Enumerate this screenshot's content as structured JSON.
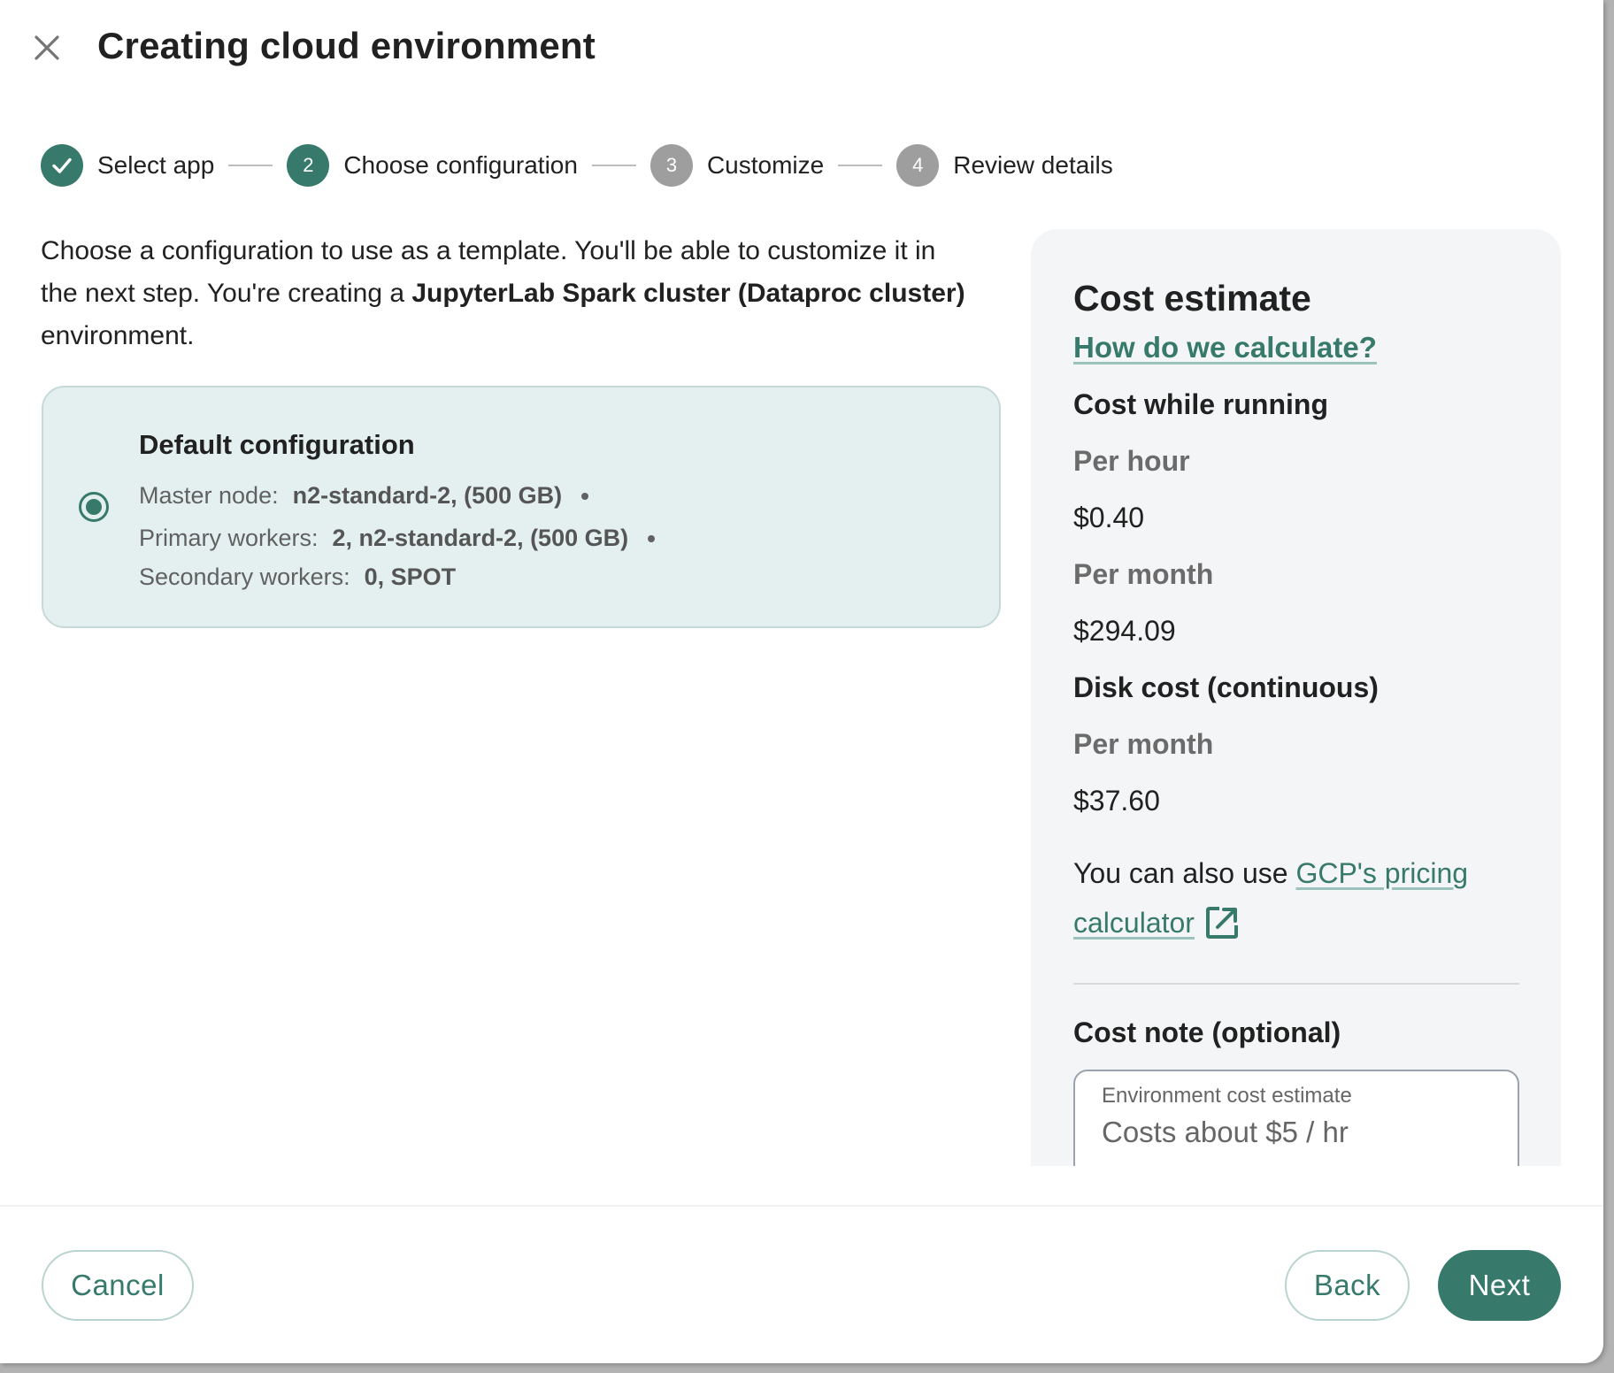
{
  "dialog": {
    "title": "Creating cloud environment",
    "close_icon": "close-icon"
  },
  "stepper": {
    "steps": [
      {
        "number": "1",
        "label": "Select app",
        "status": "done",
        "icon": "check-icon"
      },
      {
        "number": "2",
        "label": "Choose configuration",
        "status": "active"
      },
      {
        "number": "3",
        "label": "Customize",
        "status": "pending"
      },
      {
        "number": "4",
        "label": "Review details",
        "status": "pending"
      }
    ]
  },
  "description": {
    "text_before": "Choose a configuration to use as a template. You'll be able to customize it in the next step. You're creating a ",
    "app_name": "JupyterLab Spark cluster (Dataproc cluster)",
    "text_after": " environment."
  },
  "configurations": [
    {
      "title": "Default configuration",
      "selected": true,
      "details": [
        {
          "label": "Master node:",
          "value": "n2-standard-2, (500 GB)",
          "separator": true
        },
        {
          "label": "Primary workers:",
          "value": "2, n2-standard-2, (500 GB)",
          "separator": true
        },
        {
          "label": "Secondary workers:",
          "value": "0, SPOT",
          "separator": false
        }
      ]
    }
  ],
  "cost_panel": {
    "title": "Cost estimate",
    "calc_link": "How do we calculate?",
    "running": {
      "heading": "Cost while running",
      "per_hour_label": "Per hour",
      "per_hour_value": "$0.40",
      "per_month_label": "Per month",
      "per_month_value": "$294.09"
    },
    "disk": {
      "heading": "Disk cost (continuous)",
      "per_month_label": "Per month",
      "per_month_value": "$37.60"
    },
    "pricing_text": "You can also use ",
    "pricing_link": "GCP's pricing calculator",
    "pricing_icon": "external-link-icon",
    "note": {
      "heading": "Cost note (optional)",
      "field_label": "Environment cost estimate",
      "field_value": "Costs about $5 / hr"
    }
  },
  "footer": {
    "cancel_label": "Cancel",
    "back_label": "Back",
    "next_label": "Next"
  },
  "colors": {
    "accent": "#377a6b",
    "pending_step": "#9e9e9e",
    "card_bg": "#e4f0f0",
    "panel_bg": "#f4f5f6"
  }
}
